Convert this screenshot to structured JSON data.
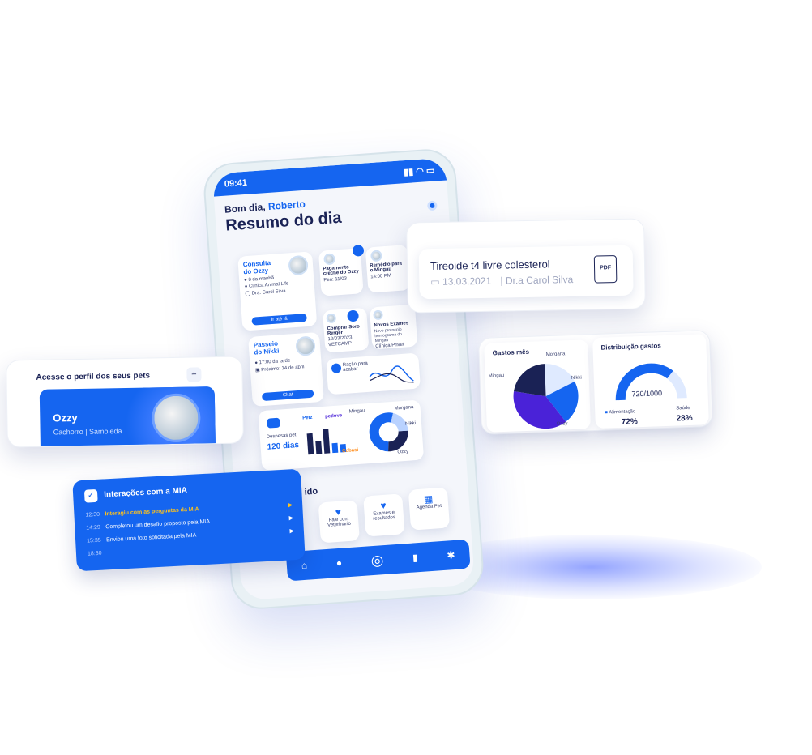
{
  "status": {
    "time": "09:41"
  },
  "header": {
    "greeting": "Bom dia,",
    "user_name": "Roberto",
    "title": "Resumo do dia"
  },
  "consulta": {
    "title": "Consulta do Ozzy",
    "time": "8 da manhã",
    "clinic": "Clínica Animal Life",
    "doctor": "Dra. Carol Silva",
    "button": "Ir até lá"
  },
  "pagamento": {
    "title": "Pagamento creche do Ozzy",
    "value": "Pen: 11/03"
  },
  "remedio": {
    "title": "Remédio para o Mingau",
    "time": "14:00 PM"
  },
  "passeio": {
    "title": "Passeio do Nikki",
    "time": "17:00 da tarde",
    "next": "Próximo: 14 de abril",
    "button": "Chat"
  },
  "comprar": {
    "title": "Comprar Soro Ringer",
    "date": "12/03/2023",
    "store": "VETCAMP"
  },
  "novos_exames": {
    "title": "Novos Exames",
    "desc": "Novo protocolo hemograma do Mingau",
    "clinic": "Clínica Privet"
  },
  "racao": {
    "title": "Ração para acabar"
  },
  "despesas": {
    "label": "Despesas pet",
    "value": "120 dias",
    "brands": [
      "Petz",
      "petlove",
      "Cobasi"
    ],
    "pets": [
      "Mingau",
      "Morgana",
      "Nikki",
      "Ozzy"
    ]
  },
  "suggestions": {
    "heading": "ido",
    "items": [
      "Fale com Veterinário",
      "Exames e resultados",
      "Agenda Pet"
    ]
  },
  "exam_card": {
    "title": "Tireoide t4 livre colesterol",
    "date": "13.03.2021",
    "doctor": "Dr.a Carol Silva",
    "file_badge": "PDF"
  },
  "pet_profile": {
    "heading": "Acesse o perfil dos seus pets",
    "add": "+",
    "pet_name": "Ozzy",
    "pet_desc": "Cachorro | Samoieda"
  },
  "mia": {
    "title": "Interações com a MIA",
    "items": [
      {
        "time": "12:30",
        "text": "Interagiu com as perguntas da MIA"
      },
      {
        "time": "14:29",
        "text": "Completou um desafio proposto pela MIA"
      },
      {
        "time": "15:35",
        "text": "Enviou uma foto solicitada pela MIA"
      },
      {
        "time": "18:30",
        "text": ""
      }
    ]
  },
  "stats": {
    "gastos_title": "Gastos mês",
    "dist_title": "Distribuição gastos",
    "pets": [
      "Morgana",
      "Mingau",
      "Nikki",
      "Ozzy"
    ],
    "gauge_label": "720/1000",
    "legend": [
      {
        "label": "Alimentação",
        "value": "72%"
      },
      {
        "label": "Saúde",
        "value": "28%"
      }
    ]
  },
  "chart_data": [
    {
      "type": "pie",
      "title": "Gastos mês",
      "categories": [
        "Morgana",
        "Nikki",
        "Ozzy",
        "Mingau"
      ],
      "values": [
        18,
        22,
        38,
        22
      ]
    },
    {
      "type": "gauge",
      "title": "Distribuição gastos",
      "value": 720,
      "max": 1000
    }
  ],
  "colors": {
    "accent": "#1565f0",
    "dark": "#1a2255",
    "purple": "#4a22d8",
    "yellow": "#ffc21a"
  }
}
